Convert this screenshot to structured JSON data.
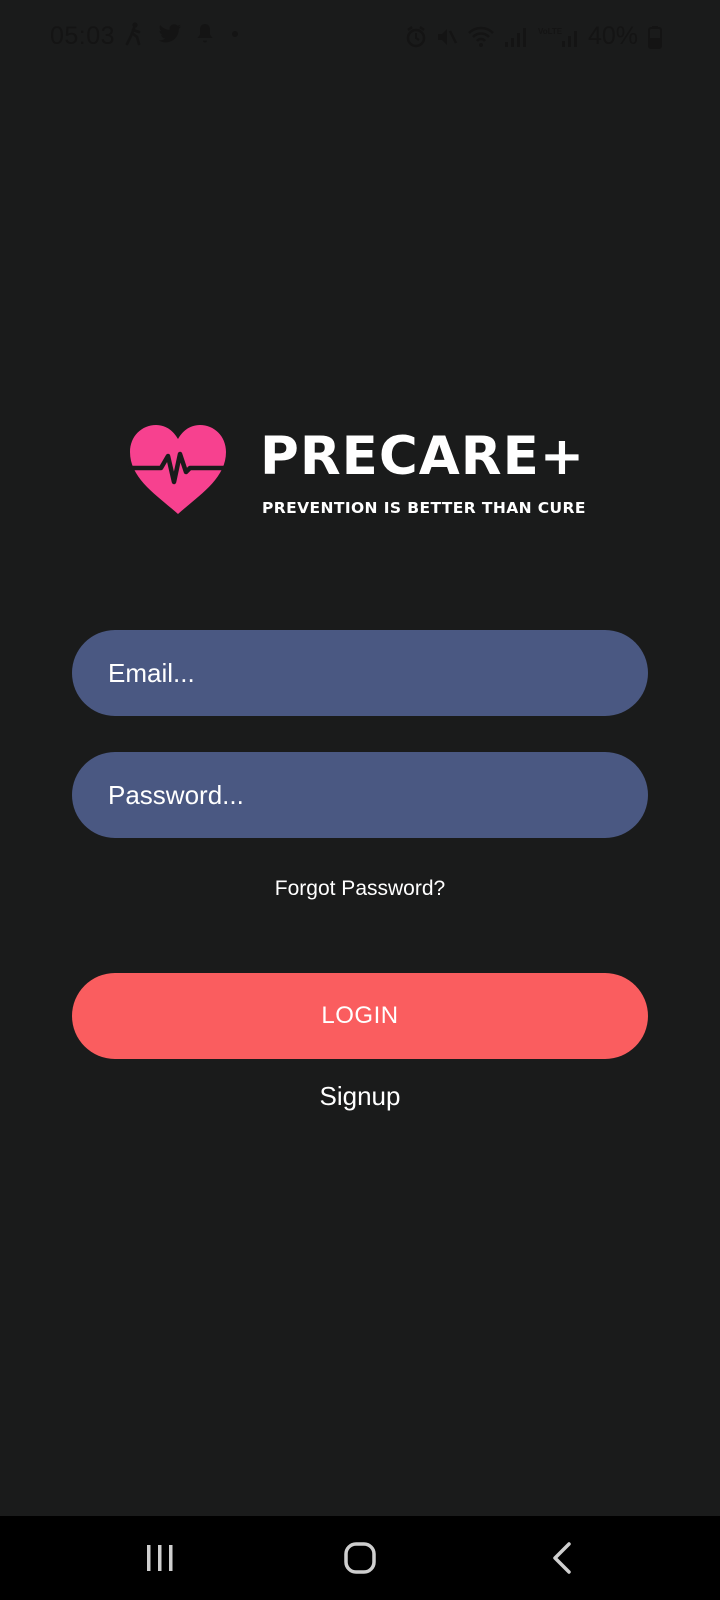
{
  "status_bar": {
    "time": "05:03",
    "battery": "40%",
    "left_icons": [
      "walking-icon",
      "twitter-icon",
      "notification-icon",
      "dot-icon"
    ],
    "right_icons": [
      "alarm-icon",
      "mute-icon",
      "wifi-icon",
      "signal-icon",
      "volte-signal-icon",
      "battery-icon"
    ]
  },
  "logo": {
    "title": "PRECARE+",
    "tagline": "PREVENTION IS BETTER THAN CURE",
    "heart_color": "#f7418f"
  },
  "form": {
    "email_placeholder": "Email...",
    "password_placeholder": "Password...",
    "forgot_label": "Forgot Password?",
    "login_label": "LOGIN",
    "signup_label": "Signup"
  },
  "colors": {
    "background": "#1a1b1b",
    "input_fill": "#4a5882",
    "login_button": "#fa5d5f"
  },
  "nav_bar": {
    "icons": [
      "recent-apps-icon",
      "home-icon",
      "back-icon"
    ]
  }
}
